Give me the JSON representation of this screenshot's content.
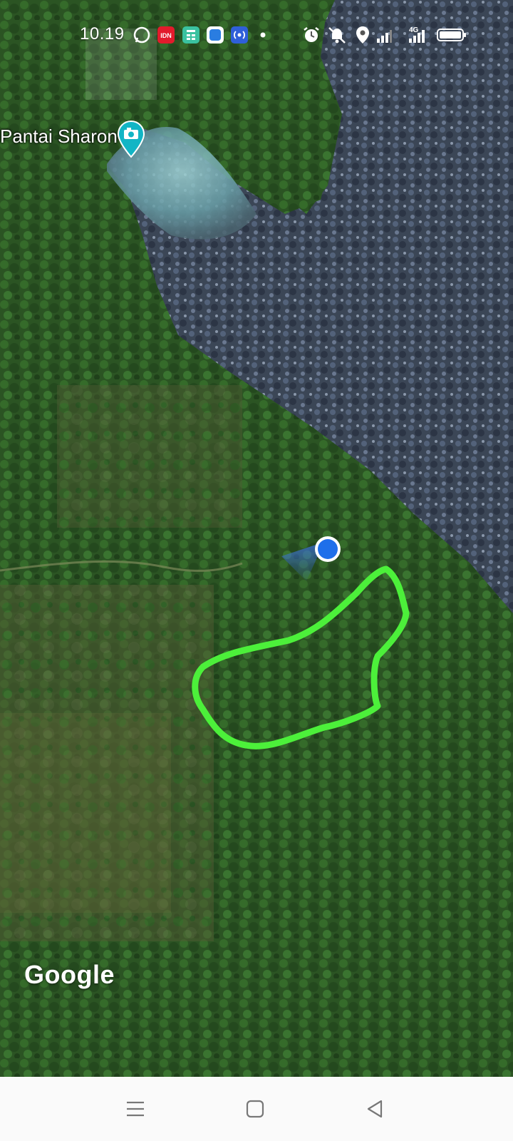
{
  "status_bar": {
    "time": "10.19",
    "notification_icons": [
      "whatsapp-icon",
      "idn-app-icon",
      "calculator-app-icon",
      "blue-app-icon",
      "hotspot-app-icon",
      "dot-icon"
    ],
    "idn_label": "IDN",
    "system_icons": [
      "alarm-icon",
      "mute-icon",
      "location-icon",
      "signal-icon",
      "4g-signal-icon",
      "battery-icon"
    ],
    "network_label": "4G"
  },
  "map": {
    "place_label": "Pantai Sharon",
    "place_icon": "camera-pin-icon",
    "attribution": "Google",
    "colors": {
      "land": "#2d5a25",
      "sea": "#3c4757",
      "outline": "#4cf03a",
      "location_dot": "#1e6fea"
    }
  },
  "nav_bar": {
    "buttons": [
      "menu-icon",
      "home-icon",
      "back-icon"
    ]
  }
}
